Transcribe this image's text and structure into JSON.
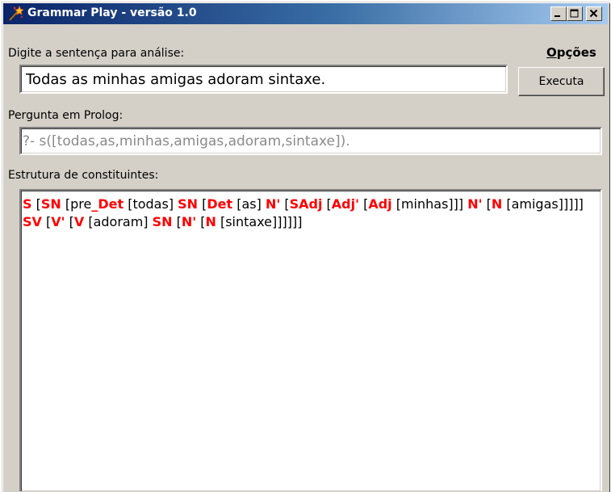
{
  "window": {
    "title": "Grammar Play - versão 1.0",
    "buttons": [
      "minimize",
      "maximize",
      "close"
    ]
  },
  "menu": {
    "options_prefix": "O",
    "options_rest": "pções"
  },
  "sentence": {
    "label": "Digite a sentença para análise:",
    "value": "Todas as minhas amigas adoram sintaxe."
  },
  "execute_button": {
    "label": "Executa"
  },
  "prolog": {
    "label": "Pergunta em Prolog:",
    "query": "?- s([todas,as,minhas,amigas,adoram,sintaxe])."
  },
  "structure": {
    "label": "Estrutura de constituintes:",
    "tokens": [
      {
        "t": "S",
        "cat": true
      },
      {
        "t": " [",
        "cat": false
      },
      {
        "t": "SN",
        "cat": true
      },
      {
        "t": " [pre",
        "cat": false
      },
      {
        "t": "_Det",
        "cat": true
      },
      {
        "t": " [todas] ",
        "cat": false
      },
      {
        "t": "SN",
        "cat": true
      },
      {
        "t": " [",
        "cat": false
      },
      {
        "t": "Det",
        "cat": true
      },
      {
        "t": " [as] ",
        "cat": false
      },
      {
        "t": "N'",
        "cat": true
      },
      {
        "t": " [",
        "cat": false
      },
      {
        "t": "SAdj",
        "cat": true
      },
      {
        "t": " [",
        "cat": false
      },
      {
        "t": "Adj'",
        "cat": true
      },
      {
        "t": " [",
        "cat": false
      },
      {
        "t": "Adj",
        "cat": true
      },
      {
        "t": " [minhas]]] ",
        "cat": false
      },
      {
        "t": "N'",
        "cat": true
      },
      {
        "t": " [",
        "cat": false
      },
      {
        "t": "N",
        "cat": true
      },
      {
        "t": " [amigas]]]]] ",
        "cat": false
      },
      {
        "t": "SV",
        "cat": true
      },
      {
        "t": " [",
        "cat": false
      },
      {
        "t": "V'",
        "cat": true
      },
      {
        "t": " [",
        "cat": false
      },
      {
        "t": "V",
        "cat": true
      },
      {
        "t": " [adoram] ",
        "cat": false
      },
      {
        "t": "SN",
        "cat": true
      },
      {
        "t": " [",
        "cat": false
      },
      {
        "t": "N'",
        "cat": true
      },
      {
        "t": " [",
        "cat": false
      },
      {
        "t": "N",
        "cat": true
      },
      {
        "t": " [sintaxe]]]]]]",
        "cat": false
      }
    ]
  },
  "colors": {
    "category": "#ff0000",
    "title_bar_start": "#0a246a",
    "title_bar_end": "#a6caf0",
    "window_face": "#d4d0c8",
    "prolog_text": "#8a8a8a"
  },
  "icons": {
    "app": "magic-wand-icon"
  }
}
